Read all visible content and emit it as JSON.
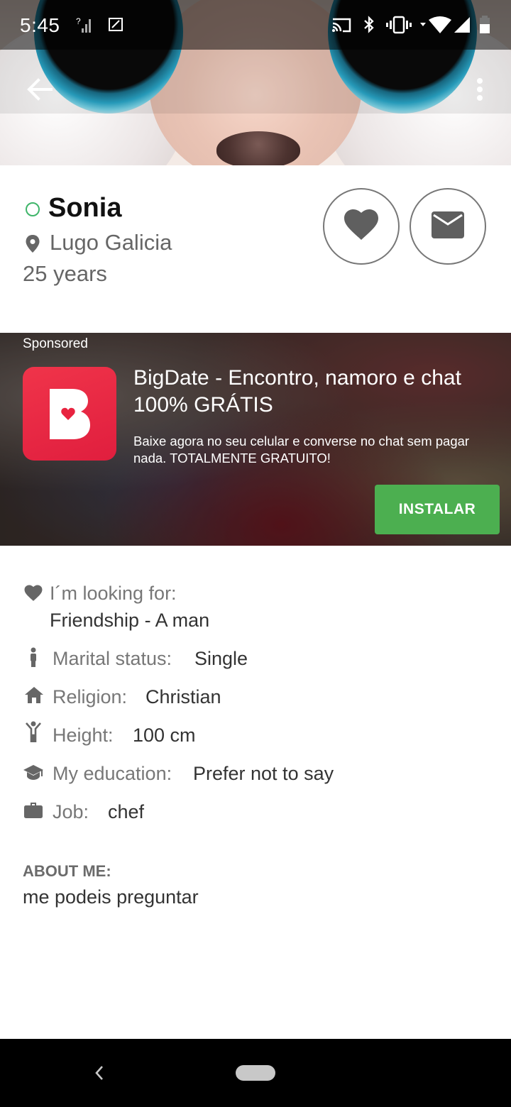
{
  "status_bar": {
    "time": "5:45",
    "icons": [
      "signal-unknown-icon",
      "screenshot-icon",
      "cast-icon",
      "bluetooth-icon",
      "vibrate-icon",
      "wifi-icon",
      "cellular-icon",
      "battery-icon"
    ]
  },
  "app_bar": {
    "back_icon": "arrow-back-icon",
    "menu_icon": "more-vert-icon"
  },
  "profile": {
    "name": "Sonia",
    "online": true,
    "location": "Lugo Galicia",
    "age": "25 years",
    "actions": [
      "like-heart",
      "message-envelope"
    ]
  },
  "ad": {
    "sponsored_label": "Sponsored",
    "title": "BigDate - Encontro, namoro e chat 100% GRÁTIS",
    "description": "Baixe agora no seu celular e converse no chat sem pagar nada. TOTALMENTE GRATUITO!",
    "cta_label": "INSTALAR",
    "cta_color": "#4caf50",
    "logo_color": "#e8233f"
  },
  "details": {
    "looking_for_label": "I´m looking for:",
    "looking_for_value": "Friendship - A man",
    "marital_label": "Marital status:",
    "marital_value": "Single",
    "religion_label": "Religion:",
    "religion_value": "Christian",
    "height_label": "Height:",
    "height_value": "100 cm",
    "education_label": "My education:",
    "education_value": "Prefer not to say",
    "job_label": "Job:",
    "job_value": "chef"
  },
  "about": {
    "title": "ABOUT ME:",
    "text": "me podeis preguntar"
  },
  "colors": {
    "online": "#3fb56a",
    "text_secondary": "#777777",
    "text_primary": "#333333"
  }
}
